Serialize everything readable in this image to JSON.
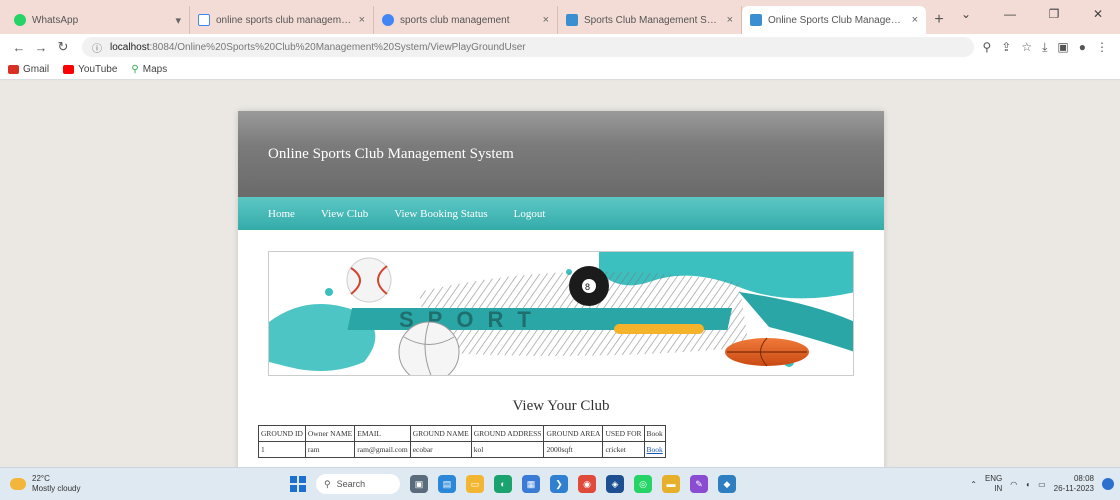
{
  "browser": {
    "tabs": [
      {
        "title": "WhatsApp",
        "color": "#25d366"
      },
      {
        "title": "online sports club management",
        "color": "#4285f4"
      },
      {
        "title": "sports club management",
        "color": "#4285f4"
      },
      {
        "title": "Sports Club Management Syst...",
        "color": "#3b8ed0"
      },
      {
        "title": "Online Sports Club Manageme...",
        "color": "#3b8ed0"
      }
    ],
    "new_tab": "+",
    "url_host": "localhost",
    "url_path": ":8084/Online%20Sports%20Club%20Management%20System/ViewPlayGroundUser",
    "bookmarks": [
      {
        "label": "Gmail",
        "color": "#d93025"
      },
      {
        "label": "YouTube",
        "color": "#ff0000"
      },
      {
        "label": "Maps",
        "color": "#34a853"
      }
    ]
  },
  "site": {
    "title": "Online Sports Club Management System",
    "nav": [
      "Home",
      "View Club",
      "View Booking Status",
      "Logout"
    ],
    "section_title": "View Your Club",
    "table": {
      "headers": [
        "GROUND ID",
        "Owner NAME",
        "EMAIL",
        "GROUND NAME",
        "GROUND ADDRESS",
        "GROUND AREA",
        "USED FOR",
        "Book"
      ],
      "rows": [
        [
          "1",
          "ram",
          "ram@gmail.com",
          "ecobar",
          "kol",
          "2000sqft",
          "cricket",
          "Book"
        ]
      ]
    }
  },
  "taskbar": {
    "temp": "22°C",
    "weather": "Mostly cloudy",
    "search_placeholder": "Search",
    "lang": "ENG",
    "region": "IN",
    "time": "08:08",
    "date": "26-11-2023"
  },
  "colors": {
    "header_gray": "#6a6a6a",
    "nav_teal": "#34acaa",
    "link_blue": "#1a55b8"
  }
}
